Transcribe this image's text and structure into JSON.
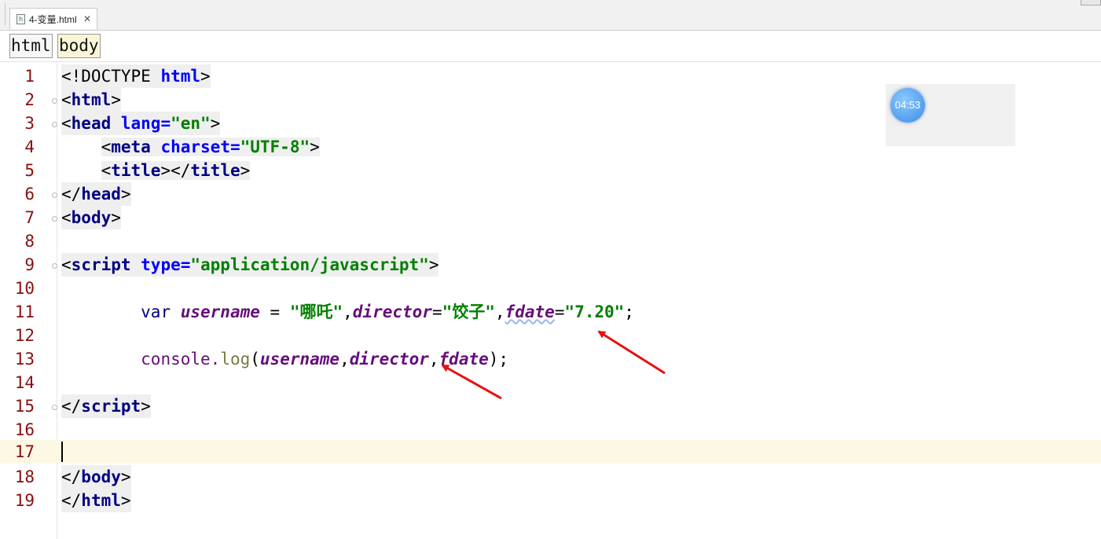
{
  "tab": {
    "title": "4-变量.html",
    "close": "✕",
    "file_icon": "h"
  },
  "breadcrumb": [
    "html",
    "body"
  ],
  "clock": {
    "time": "04:53"
  },
  "editor": {
    "current_line": 17,
    "line_numbers": [
      "1",
      "2",
      "3",
      "4",
      "5",
      "6",
      "7",
      "8",
      "9",
      "10",
      "11",
      "12",
      "13",
      "14",
      "15",
      "16",
      "17",
      "18",
      "19"
    ],
    "lines": {
      "l1": {
        "a": "<!DOCTYPE ",
        "b": "html",
        "c": ">"
      },
      "l2": {
        "a": "<",
        "b": "html",
        "c": ">"
      },
      "l3": {
        "a": "<",
        "b": "head",
        "c": " lang=",
        "d": "\"en\"",
        "e": ">"
      },
      "l4": {
        "a": "<",
        "b": "meta",
        "c": " charset=",
        "d": "\"UTF-8\"",
        "e": ">"
      },
      "l5": {
        "a": "<",
        "b": "title",
        "c": "></",
        "d": "title",
        "e": ">"
      },
      "l6": {
        "a": "</",
        "b": "head",
        "c": ">"
      },
      "l7": {
        "a": "<",
        "b": "body",
        "c": ">"
      },
      "l9": {
        "a": "<",
        "b": "script",
        "c": " type=",
        "d": "\"application/javascript\"",
        "e": ">"
      },
      "l11": {
        "a": "var ",
        "b": "username",
        "c": " = ",
        "d": "\"哪吒\"",
        "e": ",",
        "f": "director",
        "g": "=",
        "h": "\"饺子\"",
        "i": ",",
        "j": "fdate",
        "k": "=",
        "l": "\"7.20\"",
        "m": ";"
      },
      "l13": {
        "a": "console.",
        "b": "log",
        "c": "(",
        "d": "username",
        "e": ",",
        "f": "director",
        "g": ",",
        "h": "fdate",
        "i": ");"
      },
      "l15": {
        "a": "</",
        "b": "script",
        "c": ">"
      },
      "l18": {
        "a": "</",
        "b": "body",
        "c": ">"
      },
      "l19": {
        "a": "</",
        "b": "html",
        "c": ">"
      }
    }
  },
  "annotations": {
    "arrow_color": "#e81010"
  }
}
